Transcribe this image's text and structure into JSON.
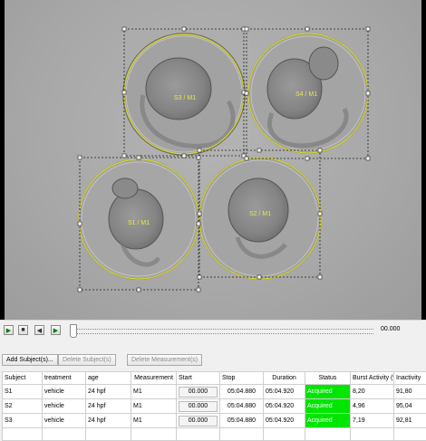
{
  "viewer": {
    "rois": [
      {
        "label": "S3 / M1"
      },
      {
        "label": "S4 / M1"
      },
      {
        "label": "S1 / M1"
      },
      {
        "label": "S2 / M1"
      }
    ]
  },
  "transport": {
    "play_icon": "play-icon",
    "stop_icon": "stop-icon",
    "prev_icon": "step-back-icon",
    "next_icon": "step-forward-icon",
    "time": "00.000"
  },
  "buttons": {
    "add_subject": "Add Subject(s)...",
    "delete_subject": "Delete Subject(s)",
    "delete_measurement": "Delete Measurement(s)"
  },
  "table": {
    "columns": [
      "Subject",
      "treatment",
      "age",
      "Measurement",
      "Start",
      "Stop",
      "Duration",
      "Status",
      "Burst Activity (%)",
      "Inactivity"
    ],
    "rows": [
      [
        "S1",
        "vehicle",
        "24 hpf",
        "M1",
        "00.000",
        "05:04.880",
        "05:04.920",
        "Acquired",
        "8,20",
        "91,80"
      ],
      [
        "S2",
        "vehicle",
        "24 hpf",
        "M1",
        "00.000",
        "05:04.880",
        "05:04.920",
        "Acquired",
        "4,96",
        "95,04"
      ],
      [
        "S3",
        "vehicle",
        "24 hpf",
        "M1",
        "00.000",
        "05:04.880",
        "05:04.920",
        "Acquired",
        "7,19",
        "92,81"
      ]
    ],
    "status_color": "#00e600"
  }
}
